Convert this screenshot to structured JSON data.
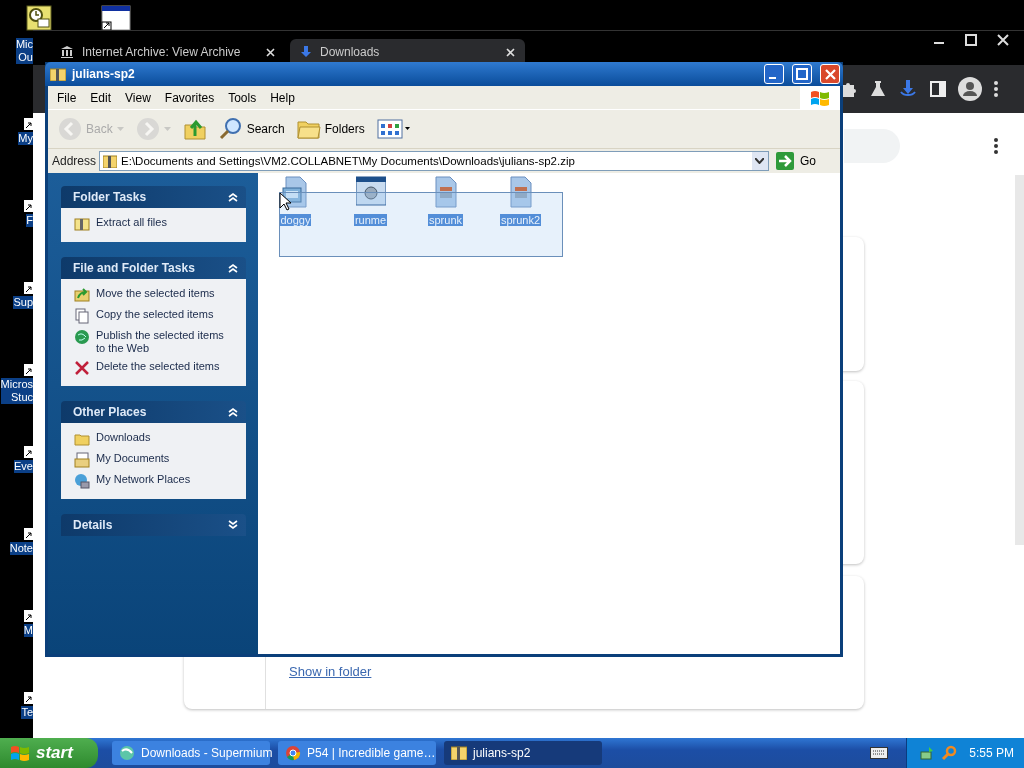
{
  "desktop_icons": [
    {
      "label": "Mic\nOu"
    },
    {
      "label": "My"
    },
    {
      "label": "F"
    },
    {
      "label": "Sup"
    },
    {
      "label": "Micros\nStuc"
    },
    {
      "label": "Eve"
    },
    {
      "label": "Note"
    },
    {
      "label": "M"
    },
    {
      "label": "Te"
    }
  ],
  "browser": {
    "tabs": [
      {
        "title": "Internet Archive: View Archive",
        "selected": false
      },
      {
        "title": "Downloads",
        "selected": true
      }
    ],
    "link": "Show in folder"
  },
  "explorer": {
    "title": "julians-sp2",
    "menu": [
      "File",
      "Edit",
      "View",
      "Favorites",
      "Tools",
      "Help"
    ],
    "toolbar": [
      {
        "kind": "back",
        "label": "Back",
        "disabled": true
      },
      {
        "kind": "forward",
        "disabled": true
      },
      {
        "kind": "up",
        "disabled": false
      },
      {
        "kind": "search",
        "label": "Search",
        "disabled": false
      },
      {
        "kind": "folders",
        "label": "Folders",
        "disabled": false
      },
      {
        "kind": "views",
        "disabled": false
      }
    ],
    "address": {
      "label": "Address",
      "value": "E:\\Documents and Settings\\VM2.COLLABNET\\My Documents\\Downloads\\julians-sp2.zip",
      "go": "Go"
    },
    "panels": [
      {
        "title": "Folder Tasks",
        "expanded": true,
        "items": [
          {
            "kind": "zip",
            "label": "Extract all files"
          }
        ]
      },
      {
        "title": "File and Folder Tasks",
        "expanded": true,
        "items": [
          {
            "kind": "move",
            "label": "Move the selected items"
          },
          {
            "kind": "copy",
            "label": "Copy the selected items"
          },
          {
            "kind": "publish",
            "label": "Publish the selected items to the Web"
          },
          {
            "kind": "delete",
            "label": "Delete the selected items"
          }
        ]
      },
      {
        "title": "Other Places",
        "expanded": true,
        "items": [
          {
            "kind": "folder",
            "label": "Downloads"
          },
          {
            "kind": "documents",
            "label": "My Documents"
          },
          {
            "kind": "network",
            "label": "My Network Places"
          }
        ]
      },
      {
        "title": "Details",
        "expanded": false
      }
    ],
    "files": [
      {
        "name": "doggy",
        "kind": "picture-doc",
        "selected": true
      },
      {
        "name": "runme",
        "kind": "window",
        "selected": true
      },
      {
        "name": "sprunk",
        "kind": "doc",
        "selected": true
      },
      {
        "name": "sprunk2",
        "kind": "doc",
        "selected": true
      }
    ]
  },
  "taskbar": {
    "start": "start",
    "tasks": [
      {
        "kind": "browser-green",
        "label": "Downloads - Supermium",
        "selected": false
      },
      {
        "kind": "browser-chrome",
        "label": "P54 | Incredible game…",
        "selected": false
      },
      {
        "kind": "zip",
        "label": "julians-sp2",
        "selected": true
      }
    ],
    "clock": "5:55 PM"
  }
}
